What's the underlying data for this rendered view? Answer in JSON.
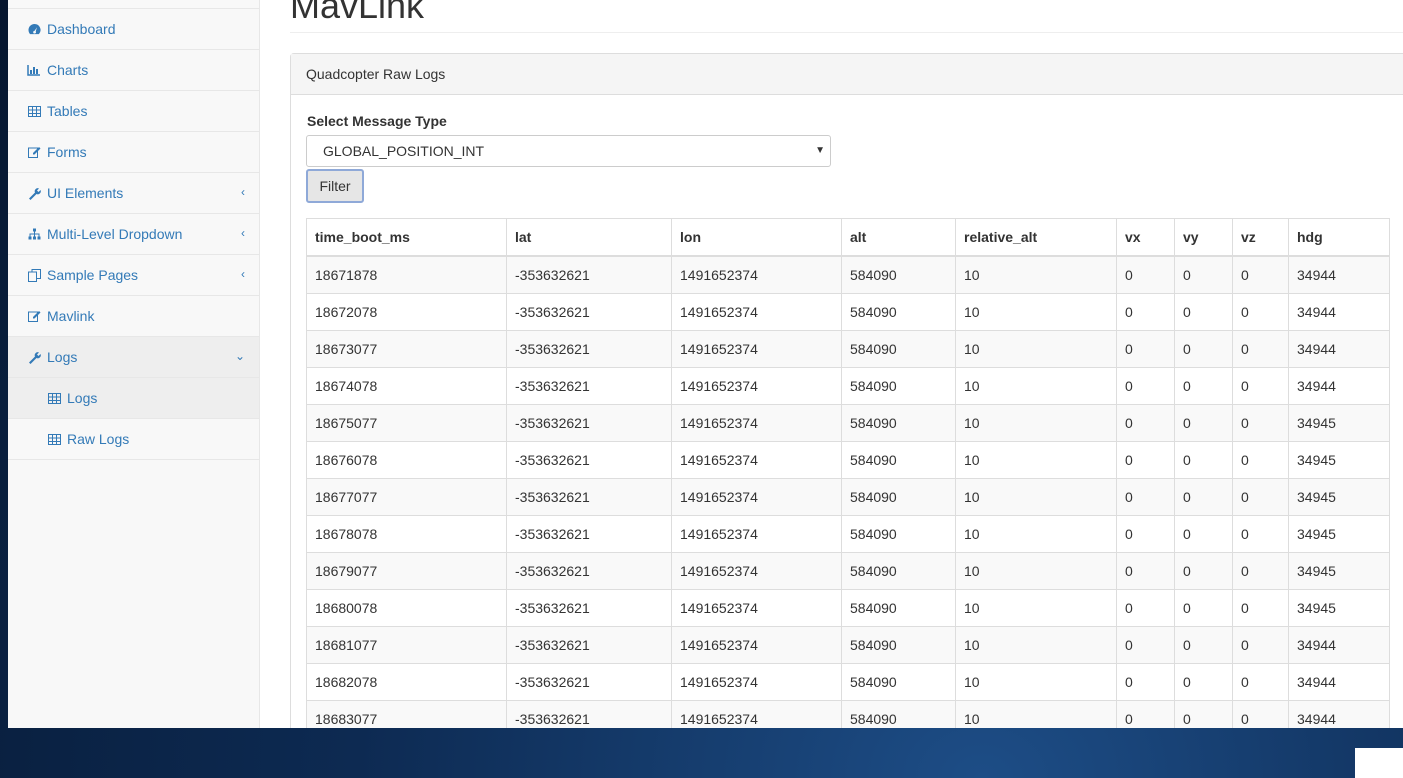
{
  "sidebar": {
    "items": [
      {
        "label": "Dashboard",
        "icon": "dashboard-icon",
        "has_arrow": false
      },
      {
        "label": "Charts",
        "icon": "bar-chart-icon",
        "has_arrow": false
      },
      {
        "label": "Tables",
        "icon": "table-icon",
        "has_arrow": false
      },
      {
        "label": "Forms",
        "icon": "edit-icon",
        "has_arrow": false
      },
      {
        "label": "UI Elements",
        "icon": "wrench-icon",
        "has_arrow": true
      },
      {
        "label": "Multi-Level Dropdown",
        "icon": "sitemap-icon",
        "has_arrow": true
      },
      {
        "label": "Sample Pages",
        "icon": "files-icon",
        "has_arrow": true
      },
      {
        "label": "Mavlink",
        "icon": "edit-icon",
        "has_arrow": false
      },
      {
        "label": "Logs",
        "icon": "wrench-icon",
        "has_arrow": true
      }
    ],
    "subitems": [
      {
        "label": "Logs",
        "icon": "table-icon"
      },
      {
        "label": "Raw Logs",
        "icon": "table-icon"
      }
    ]
  },
  "main": {
    "title": "MavLink",
    "panel_heading": "Quadcopter Raw Logs",
    "select_label": "Select Message Type",
    "select_value": "GLOBAL_POSITION_INT",
    "filter_button": "Filter"
  },
  "table": {
    "columns": [
      "time_boot_ms",
      "lat",
      "lon",
      "alt",
      "relative_alt",
      "vx",
      "vy",
      "vz",
      "hdg"
    ],
    "rows": [
      [
        "18671878",
        "-353632621",
        "1491652374",
        "584090",
        "10",
        "0",
        "0",
        "0",
        "34944"
      ],
      [
        "18672078",
        "-353632621",
        "1491652374",
        "584090",
        "10",
        "0",
        "0",
        "0",
        "34944"
      ],
      [
        "18673077",
        "-353632621",
        "1491652374",
        "584090",
        "10",
        "0",
        "0",
        "0",
        "34944"
      ],
      [
        "18674078",
        "-353632621",
        "1491652374",
        "584090",
        "10",
        "0",
        "0",
        "0",
        "34944"
      ],
      [
        "18675077",
        "-353632621",
        "1491652374",
        "584090",
        "10",
        "0",
        "0",
        "0",
        "34945"
      ],
      [
        "18676078",
        "-353632621",
        "1491652374",
        "584090",
        "10",
        "0",
        "0",
        "0",
        "34945"
      ],
      [
        "18677077",
        "-353632621",
        "1491652374",
        "584090",
        "10",
        "0",
        "0",
        "0",
        "34945"
      ],
      [
        "18678078",
        "-353632621",
        "1491652374",
        "584090",
        "10",
        "0",
        "0",
        "0",
        "34945"
      ],
      [
        "18679077",
        "-353632621",
        "1491652374",
        "584090",
        "10",
        "0",
        "0",
        "0",
        "34945"
      ],
      [
        "18680078",
        "-353632621",
        "1491652374",
        "584090",
        "10",
        "0",
        "0",
        "0",
        "34945"
      ],
      [
        "18681077",
        "-353632621",
        "1491652374",
        "584090",
        "10",
        "0",
        "0",
        "0",
        "34944"
      ],
      [
        "18682078",
        "-353632621",
        "1491652374",
        "584090",
        "10",
        "0",
        "0",
        "0",
        "34944"
      ],
      [
        "18683077",
        "-353632621",
        "1491652374",
        "584090",
        "10",
        "0",
        "0",
        "0",
        "34944"
      ]
    ]
  }
}
